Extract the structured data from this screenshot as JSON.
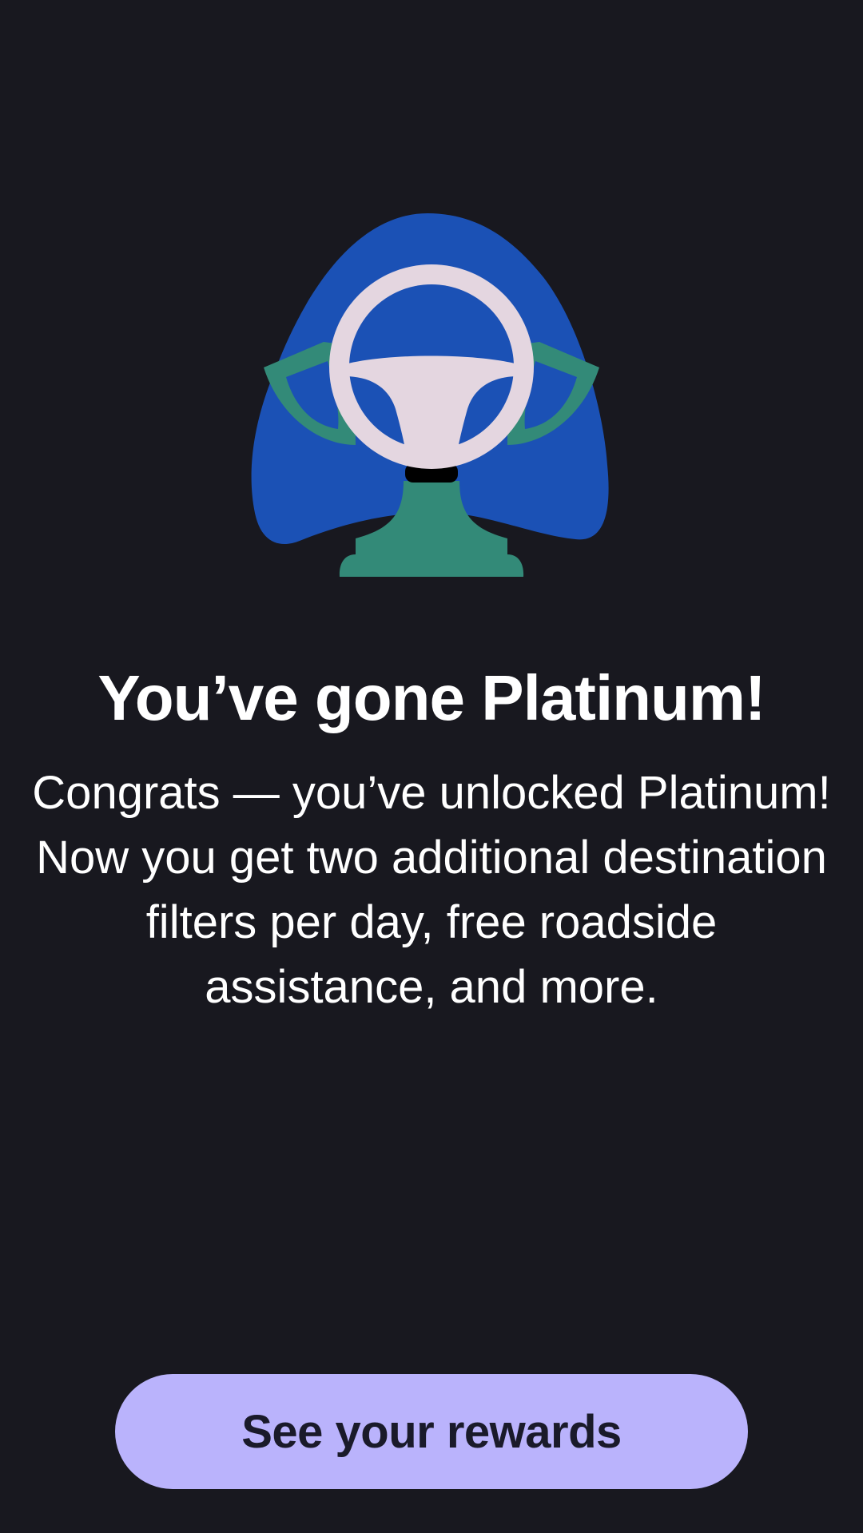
{
  "screen": {
    "background_color": "#18181f"
  },
  "illustration": {
    "icon": "steering-wheel-icon",
    "colors": {
      "blob": "#1b51b5",
      "base": "#338a78",
      "wheel": "#e4d6e0",
      "column_joint": "#000000"
    }
  },
  "title": "You’ve gone Platinum!",
  "message": "Congrats — you’ve unlocked Platinum! Now you get two additional destination filters per day, free roadside assistance, and more.",
  "cta": {
    "label": "See your rewards",
    "background_color": "#bab3fc",
    "text_color": "#1a1a2a"
  }
}
